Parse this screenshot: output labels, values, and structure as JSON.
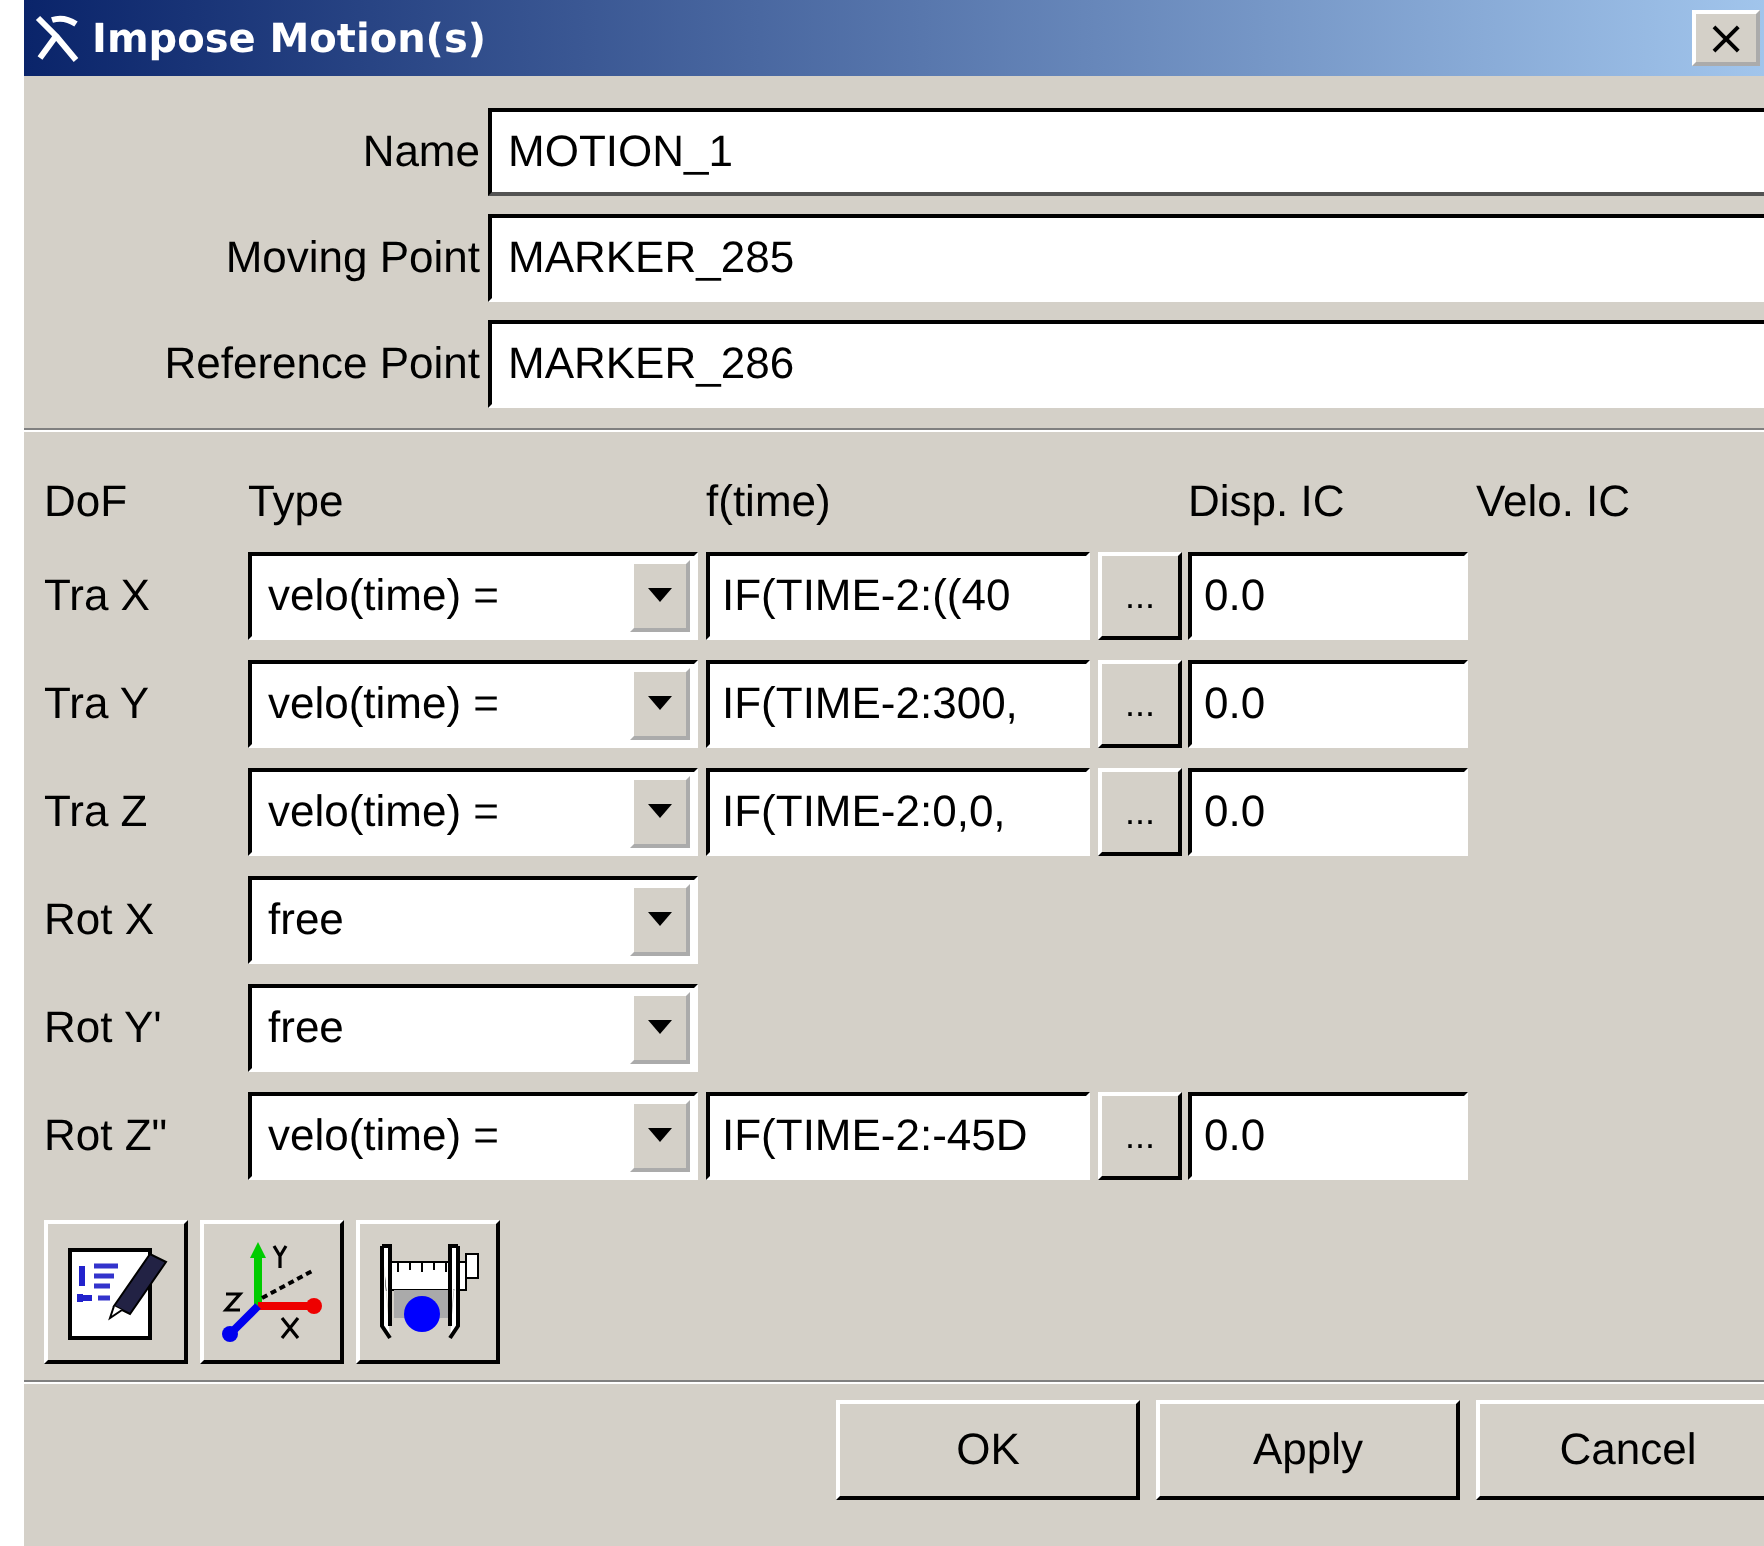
{
  "window": {
    "title": "Impose Motion(s)",
    "close": "×"
  },
  "fields": [
    {
      "label": "Name",
      "value": "MOTION_1",
      "focused": true
    },
    {
      "label": "Moving Point",
      "value": "MARKER_285",
      "focused": false
    },
    {
      "label": "Reference Point",
      "value": "MARKER_286",
      "focused": false
    }
  ],
  "columns": [
    "DoF",
    "Type",
    "f(time)",
    "Disp. IC",
    "Velo. IC"
  ],
  "rows": [
    {
      "dof": "Tra X",
      "kind": "expression",
      "type": "velo(time) =",
      "f_time": "IF(TIME-2:((40",
      "browse": "...",
      "disp_ic": "0.0"
    },
    {
      "dof": "Tra Y",
      "kind": "expression",
      "type": "velo(time) =",
      "f_time": "IF(TIME-2:300,",
      "browse": "...",
      "disp_ic": "0.0"
    },
    {
      "dof": "Tra Z",
      "kind": "expression",
      "type": "velo(time) =",
      "f_time": "IF(TIME-2:0,0,",
      "browse": "...",
      "disp_ic": "0.0"
    },
    {
      "dof": "Rot X",
      "kind": "free",
      "type": "free"
    },
    {
      "dof": "Rot Y'",
      "kind": "free",
      "type": "free"
    },
    {
      "dof": "Rot Z\"",
      "kind": "expression",
      "type": "velo(time) =",
      "f_time": "IF(TIME-2:-45D",
      "browse": "...",
      "disp_ic": "0.0"
    }
  ],
  "buttons": [
    "OK",
    "Apply",
    "Cancel"
  ]
}
